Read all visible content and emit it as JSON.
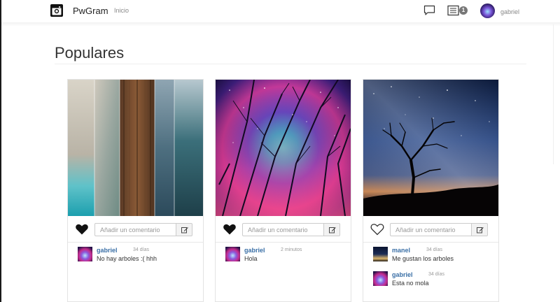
{
  "navbar": {
    "brand": "PwGram",
    "home_link": "Inicio",
    "notifications_count": "1",
    "user_name": "gabriel"
  },
  "page": {
    "title": "Populares"
  },
  "posts": [
    {
      "photo": "aerial-pier-photo",
      "liked": true,
      "comment_placeholder": "Añadir un comentario",
      "comments": [
        {
          "user": "gabriel",
          "time": "34 días",
          "text": "No hay arboles :( hhh"
        }
      ]
    },
    {
      "photo": "starry-forest-photo",
      "liked": true,
      "comment_placeholder": "Añadir un comentario",
      "comments": [
        {
          "user": "gabriel",
          "time": "2 minutos",
          "text": "Hola"
        }
      ]
    },
    {
      "photo": "night-tree-photo",
      "liked": false,
      "comment_placeholder": "Añadir un comentario",
      "comments": [
        {
          "user": "manel",
          "time": "34 días",
          "text": "Me gustan los arboles"
        },
        {
          "user": "gabriel",
          "time": "34 días",
          "text": "Esta no mola"
        }
      ]
    }
  ]
}
